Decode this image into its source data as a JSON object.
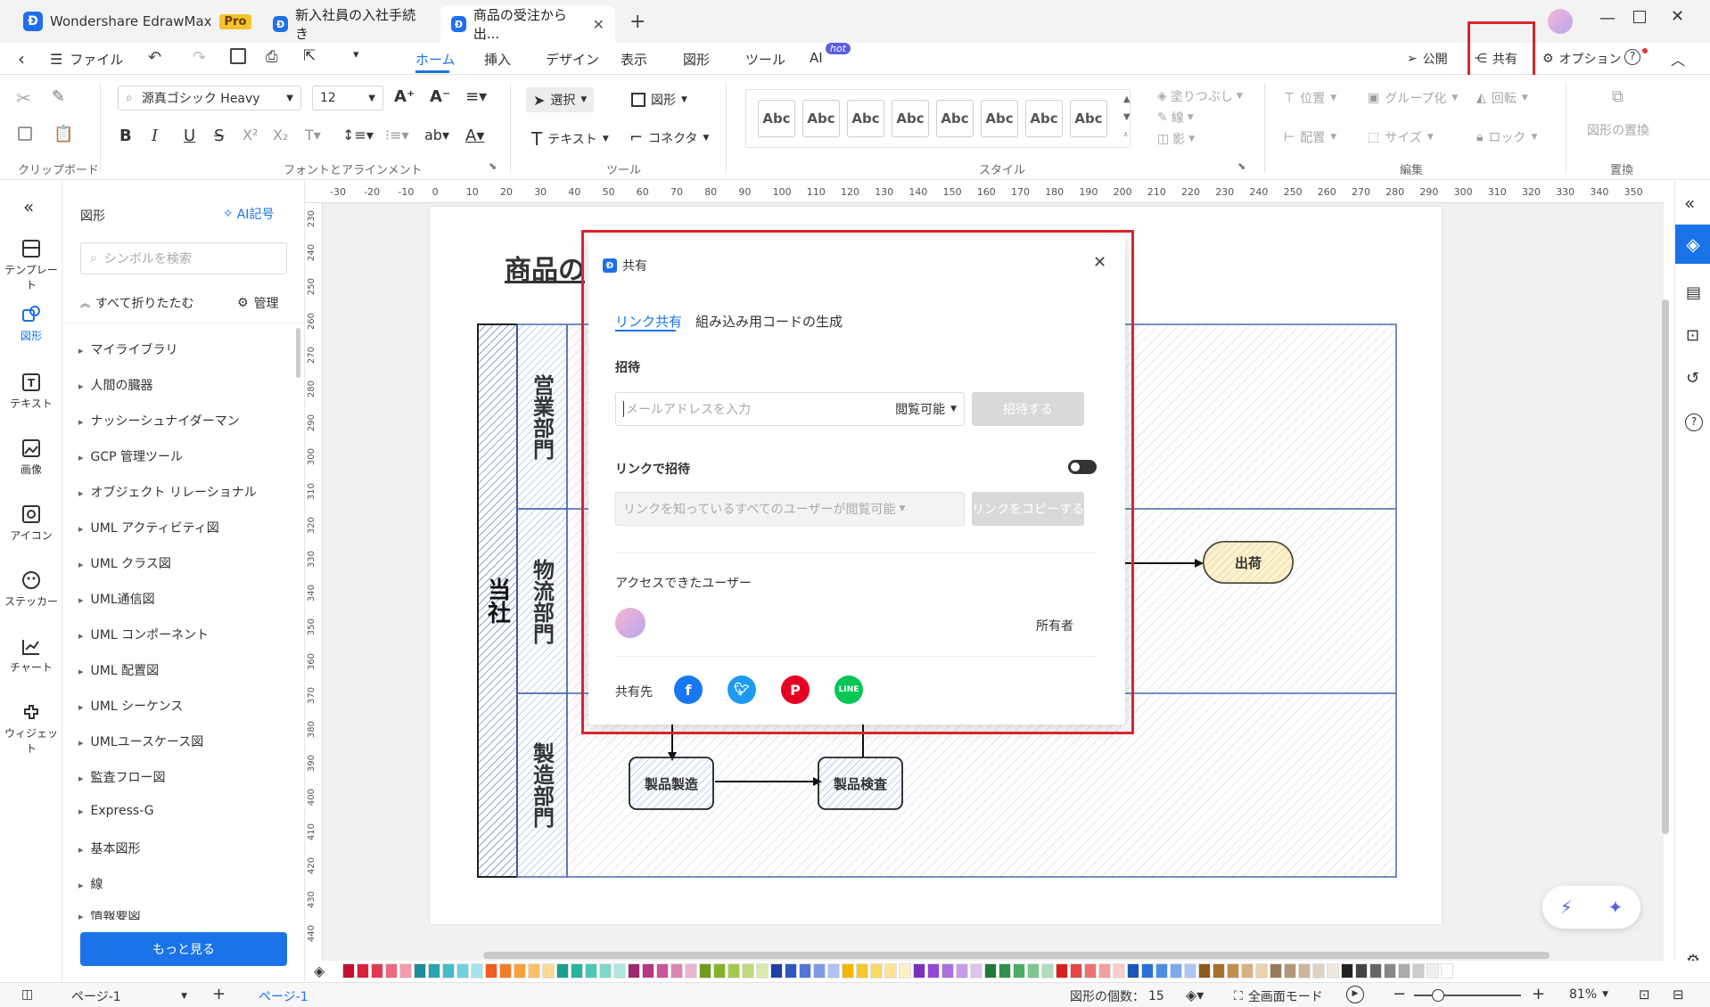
{
  "titlebar": {
    "app_name": "Wondershare EdrawMax",
    "pro_badge": "Pro",
    "tabs": [
      {
        "label": "新入社員の入社手続き"
      },
      {
        "label": "商品の受注から出..."
      }
    ]
  },
  "menu": {
    "file": "ファイル",
    "items": [
      "ホーム",
      "挿入",
      "デザイン",
      "表示",
      "図形",
      "ツール",
      "AI"
    ],
    "ai_badge": "hot",
    "publish": "公開",
    "share": "共有",
    "options": "オプション"
  },
  "ribbon": {
    "font_name": "源真ゴシック Heavy",
    "font_size": "12",
    "select_label": "選択",
    "shape_label": "図形",
    "text_label": "テキスト",
    "connector_label": "コネクタ",
    "style_sample": "Abc",
    "fill_label": "塗りつぶし",
    "line_label": "線",
    "shadow_label": "影",
    "position_label": "位置",
    "align_label": "配置",
    "group_label": "グループ化",
    "size_label": "サイズ",
    "rotate_label": "回転",
    "lock_label": "ロック",
    "replace_label": "図形の置換",
    "groups": {
      "clipboard": "クリップボード",
      "font": "フォントとアラインメント",
      "tools": "ツール",
      "style": "スタイル",
      "edit": "編集",
      "replace": "置換"
    }
  },
  "iconbar": {
    "items": [
      "テンプレート",
      "図形",
      "テキスト",
      "画像",
      "アイコン",
      "ステッカー",
      "チャート",
      "ウィジェット"
    ]
  },
  "shapes_panel": {
    "title": "図形",
    "ai_symbol": "AI記号",
    "search_placeholder": "シンボルを検索",
    "collapse_all": "すべて折りたたむ",
    "manage": "管理",
    "libraries": [
      "マイライブラリ",
      "人間の臓器",
      "ナッシーシュナイダーマン",
      "GCP 管理ツール",
      "オブジェクト リレーショナル",
      "UML アクティビティ図",
      "UML クラス図",
      "UML通信図",
      "UML コンポーネント",
      "UML 配置図",
      "UML シーケンス",
      "UMLユースケース図",
      "監査フロー図",
      "Express-G",
      "基本図形",
      "線",
      "情報要図"
    ],
    "more_button": "もっと見る"
  },
  "ruler": {
    "h_ticks": [
      "-30",
      "-20",
      "-10",
      "0",
      "10",
      "20",
      "30",
      "40",
      "50",
      "60",
      "70",
      "80",
      "90",
      "100",
      "110",
      "120",
      "130",
      "140",
      "150",
      "160",
      "170",
      "180",
      "190",
      "200",
      "210",
      "220",
      "230",
      "240",
      "250",
      "260",
      "270",
      "280",
      "290",
      "300",
      "310",
      "320",
      "330",
      "340",
      "350"
    ],
    "v_ticks": [
      "230",
      "240",
      "250",
      "260",
      "270",
      "280",
      "290",
      "300",
      "310",
      "320",
      "330",
      "340",
      "350",
      "360",
      "370",
      "380",
      "390",
      "400",
      "410",
      "420",
      "430",
      "440"
    ]
  },
  "diagram": {
    "title": "商品の",
    "pool_label": "当社",
    "lanes": [
      "営業部門",
      "物流部門",
      "製造部門"
    ],
    "nodes": {
      "ship": "出荷",
      "manufacture": "製品製造",
      "inspect": "製品検査"
    }
  },
  "dialog": {
    "title": "共有",
    "tabs": [
      "リンク共有",
      "組み込み用コードの生成"
    ],
    "invite_heading": "招待",
    "email_placeholder": "メールアドレスを入力",
    "permission": "閲覧可能",
    "invite_button": "招待する",
    "link_invite_heading": "リンクで招待",
    "link_permission": "リンクを知っているすべてのユーザーが閲覧可能",
    "copy_link_button": "リンクをコピーする",
    "access_users_heading": "アクセスできたユーザー",
    "owner_label": "所有者",
    "share_to": "共有先",
    "social": [
      "facebook",
      "twitter",
      "pinterest",
      "line"
    ]
  },
  "statusbar": {
    "page_selector": "ページ-1",
    "page_tab": "ページ-1",
    "shape_count_label": "図形の個数：",
    "shape_count": "15",
    "fullscreen": "全画面モード",
    "zoom": "81%"
  },
  "colors": {
    "accent": "#1a73e8",
    "highlight_red": "#d9262c",
    "palette": [
      "#c3102e",
      "#d8213c",
      "#e23a55",
      "#eb6a80",
      "#f29cad",
      "#1f8c9a",
      "#2aa3b4",
      "#44bccb",
      "#6fd2dc",
      "#a3e3ea",
      "#f35b1f",
      "#f47c26",
      "#f8a13a",
      "#fbc168",
      "#fcd993",
      "#18a08a",
      "#25b49d",
      "#4cc7b3",
      "#7dd8c8",
      "#b0e8dd",
      "#a0286f",
      "#b8367f",
      "#cc5598",
      "#dc84b5",
      "#eab6d2",
      "#6d9b1e",
      "#84b22b",
      "#a2c84a",
      "#c0db7b",
      "#d9eaa9",
      "#1f3fa6",
      "#2f57c4",
      "#5176d8",
      "#7c9be4",
      "#aec1ef",
      "#f2b800",
      "#f6c830",
      "#f9d762",
      "#fbe392",
      "#fdf0c3",
      "#7d2fbf",
      "#9447d3",
      "#ad6ee0",
      "#c69be9",
      "#ddc3f2",
      "#1f7a3a",
      "#2c9249",
      "#4cae66",
      "#7dc690",
      "#b0dcbb",
      "#d82020",
      "#e64545",
      "#ee7070",
      "#f4a0a0",
      "#f9cccc",
      "#1a57b8",
      "#2a6fd6",
      "#4c8de4",
      "#7ba9ec",
      "#aac7f3",
      "#8c5a1a",
      "#a77028",
      "#c48e4c",
      "#d8b080",
      "#e9d0b0",
      "#9a7c5a",
      "#b39877",
      "#cbb69b",
      "#dfd2c0",
      "#efe8dd",
      "#222222",
      "#444444",
      "#666666",
      "#888888",
      "#aaaaaa",
      "#cccccc",
      "#eeeeee",
      "#ffffff"
    ]
  }
}
